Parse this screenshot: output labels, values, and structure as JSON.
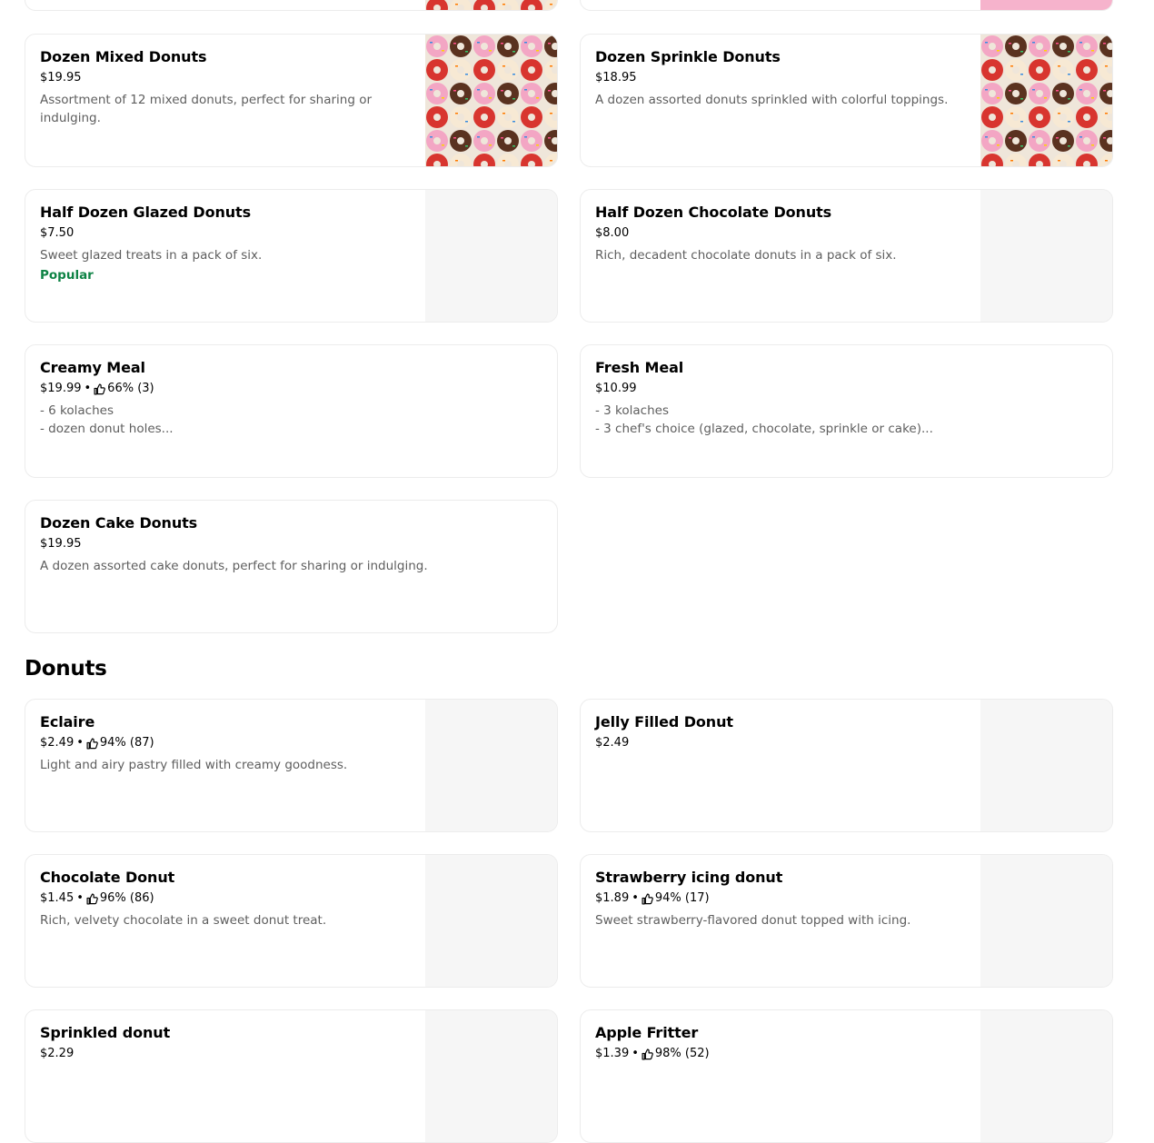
{
  "colors": {
    "popular": "#0e8345",
    "description": "#5e5e5e",
    "border": "#ececec",
    "image_placeholder": "#f6f6f6"
  },
  "icons": {
    "rating": "thumbs-up-icon"
  },
  "top_cards": [
    {
      "name": "Dozen Mixed Donuts",
      "price": "$19.95",
      "description": [
        "Assortment of 12 mixed donuts, perfect for sharing or",
        "indulging."
      ],
      "image": "assorted-donuts-photo"
    },
    {
      "name": "Dozen Sprinkle Donuts",
      "price": "$18.95",
      "description": [
        "A dozen assorted donuts sprinkled with colorful toppings."
      ],
      "image": "assorted-donuts-photo"
    },
    {
      "name": "Half Dozen Glazed Donuts",
      "price": "$7.50",
      "description": [
        "Sweet glazed treats in a pack of six."
      ],
      "tag": "Popular"
    },
    {
      "name": "Half Dozen Chocolate Donuts",
      "price": "$8.00",
      "description": [
        "Rich, decadent chocolate donuts in a pack of six."
      ]
    },
    {
      "name": "Creamy Meal",
      "price": "$19.99",
      "rating": "66% (3)",
      "description": [
        "- 6 kolaches",
        "- dozen donut holes..."
      ]
    },
    {
      "name": "Fresh Meal",
      "price": "$10.99",
      "description": [
        "- 3 kolaches",
        "- 3 chef's choice (glazed, chocolate, sprinkle or cake)..."
      ]
    },
    {
      "name": "Dozen Cake Donuts",
      "price": "$19.95",
      "description": [
        "A dozen assorted cake donuts, perfect for sharing or indulging."
      ]
    }
  ],
  "donuts_section": {
    "title": "Donuts",
    "items": [
      {
        "name": "Eclaire",
        "price": "$2.49",
        "rating": "94% (87)",
        "description": [
          "Light and airy pastry filled with creamy goodness."
        ]
      },
      {
        "name": "Jelly Filled Donut",
        "price": "$2.49"
      },
      {
        "name": "Chocolate Donut",
        "price": "$1.45",
        "rating": "96% (86)",
        "description": [
          "Rich, velvety chocolate in a sweet donut treat."
        ]
      },
      {
        "name": "Strawberry icing donut",
        "price": "$1.89",
        "rating": "94% (17)",
        "description": [
          "Sweet strawberry-flavored donut topped with icing."
        ]
      },
      {
        "name": "Sprinkled donut",
        "price": "$2.29"
      },
      {
        "name": "Apple Fritter",
        "price": "$1.39",
        "rating": "98% (52)"
      }
    ]
  }
}
